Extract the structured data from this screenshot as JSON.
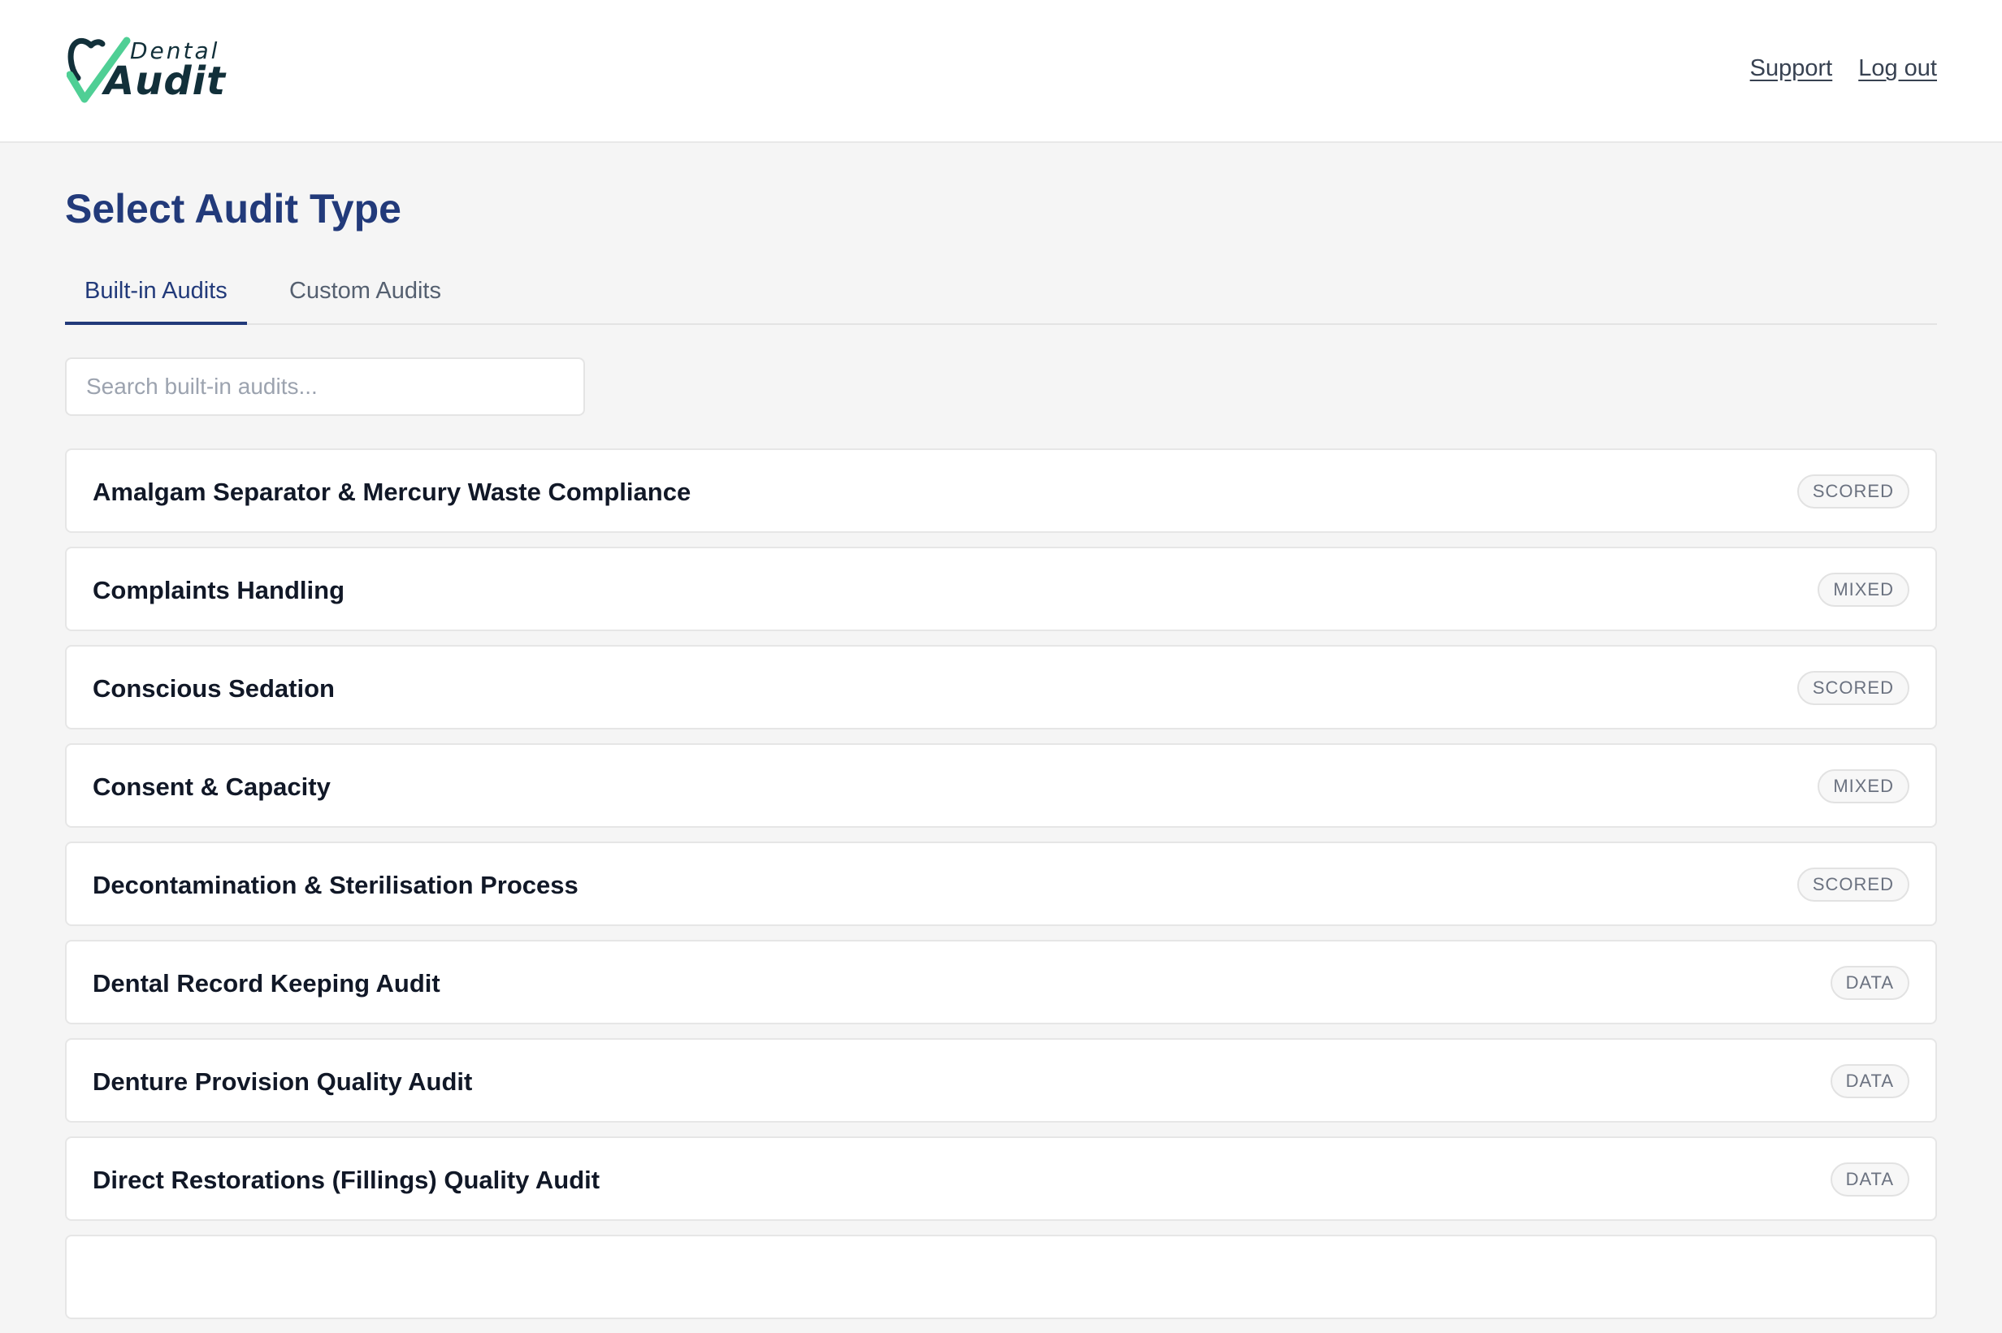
{
  "header": {
    "logo": {
      "top_text": "Dental",
      "main_text": "Audit"
    },
    "nav": {
      "support": "Support",
      "logout": "Log out"
    }
  },
  "page": {
    "title": "Select Audit Type"
  },
  "tabs": [
    {
      "label": "Built-in Audits",
      "active": true
    },
    {
      "label": "Custom Audits",
      "active": false
    }
  ],
  "search": {
    "placeholder": "Search built-in audits...",
    "value": ""
  },
  "audits": [
    {
      "title": "Amalgam Separator & Mercury Waste Compliance",
      "type": "SCORED"
    },
    {
      "title": "Complaints Handling",
      "type": "MIXED"
    },
    {
      "title": "Conscious Sedation",
      "type": "SCORED"
    },
    {
      "title": "Consent & Capacity",
      "type": "MIXED"
    },
    {
      "title": "Decontamination & Sterilisation Process",
      "type": "SCORED"
    },
    {
      "title": "Dental Record Keeping Audit",
      "type": "DATA"
    },
    {
      "title": "Denture Provision Quality Audit",
      "type": "DATA"
    },
    {
      "title": "Direct Restorations (Fillings) Quality Audit",
      "type": "DATA"
    }
  ],
  "colors": {
    "brand_navy": "#223a7a",
    "logo_teal": "#12303a",
    "logo_check_green": "#4fcf95"
  }
}
